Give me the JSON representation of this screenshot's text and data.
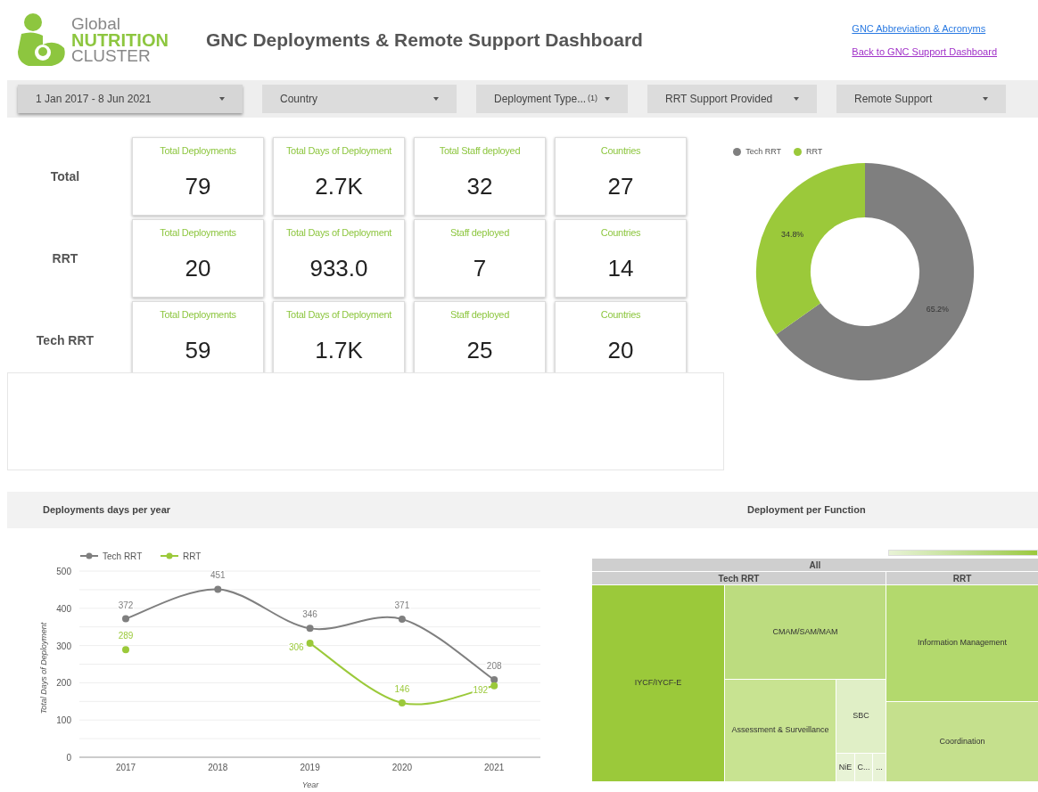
{
  "logo": {
    "line_1": "Global",
    "line_2": "NUTRITION",
    "line_3": "CLUSTER"
  },
  "title": "GNC Deployments & Remote Support Dashboard",
  "links": [
    {
      "label": "GNC Abbreviation & Acronyms",
      "visited": false
    },
    {
      "label": "Back to GNC Support Dashboard",
      "visited": true
    }
  ],
  "filters": [
    {
      "label": "1 Jan 2017 - 8 Jun 2021",
      "kind": "date"
    },
    {
      "label": "Country",
      "kind": "dropdown"
    },
    {
      "label": "Deployment Type...",
      "kind": "dropdown",
      "count": "(1)"
    },
    {
      "label": "RRT Support Provided",
      "kind": "dropdown"
    },
    {
      "label": "Remote Support",
      "kind": "dropdown"
    }
  ],
  "kpi_rows": [
    {
      "label": "Total",
      "cards": [
        {
          "title": "Total Deployments",
          "value": "79"
        },
        {
          "title": "Total Days of Deployment",
          "value": "2.7K"
        },
        {
          "title": "Total Staff deployed",
          "value": "32"
        },
        {
          "title": "Countries",
          "value": "27"
        }
      ]
    },
    {
      "label": "RRT",
      "cards": [
        {
          "title": "Total Deployments",
          "value": "20"
        },
        {
          "title": "Total Days of Deployment",
          "value": "933.0"
        },
        {
          "title": "Staff deployed",
          "value": "7"
        },
        {
          "title": "Countries",
          "value": "14"
        }
      ]
    },
    {
      "label": "Tech RRT",
      "cards": [
        {
          "title": "Total Deployments",
          "value": "59"
        },
        {
          "title": "Total Days of Deployment",
          "value": "1.7K"
        },
        {
          "title": "Staff deployed",
          "value": "25"
        },
        {
          "title": "Countries",
          "value": "20"
        }
      ]
    }
  ],
  "donut": {
    "chart_data": {
      "type": "donut",
      "legend": "top-left",
      "categories": [
        "Tech RRT",
        "RRT"
      ],
      "values": [
        65.2,
        34.8
      ],
      "colors": [
        "#7f7f7f",
        "#9bc93a"
      ],
      "value_labels": [
        "65.2%",
        "34.8%"
      ]
    }
  },
  "sections": [
    {
      "title": "Deployments days per year"
    },
    {
      "title": "Deployment per Function"
    }
  ],
  "line_chart": {
    "chart_data": {
      "type": "line",
      "legend": "top-left",
      "grid": true,
      "xlabel": "Year",
      "ylabel": "Total Days of Deployment",
      "categories": [
        "2017",
        "2018",
        "2019",
        "2020",
        "2021"
      ],
      "ylim": [
        0,
        500
      ],
      "yticks": [
        0,
        100,
        200,
        300,
        400,
        500
      ],
      "data_labels": true,
      "series": [
        {
          "name": "Tech RRT",
          "color": "#7f7f7f",
          "marker": "circle",
          "values": [
            372,
            451,
            346,
            371,
            208
          ]
        },
        {
          "name": "RRT",
          "color": "#9bc93a",
          "marker": "circle",
          "values": [
            289,
            null,
            306,
            146,
            192
          ]
        }
      ]
    }
  },
  "treemap": {
    "header": "All",
    "groups": [
      {
        "label": "Tech RRT",
        "cells": [
          {
            "label": "IYCF/IYCF-E",
            "color": "#9bc93a"
          },
          {
            "label": "CMAM/SAM/MAM",
            "color": "#bcdc7f"
          },
          {
            "label": "Assessment & Surveillance",
            "color": "#c8e391"
          },
          {
            "label": "SBC",
            "color": "#e0efc6"
          },
          {
            "label": "NiE",
            "color": "#e8f3d6"
          },
          {
            "label": "C...",
            "color": "#e8f3d6"
          },
          {
            "label": "...",
            "color": "#e8f3d6"
          }
        ]
      },
      {
        "label": "RRT",
        "cells": [
          {
            "label": "Information Management",
            "color": "#b3d96d"
          },
          {
            "label": "Coordination",
            "color": "#c5e08d"
          }
        ]
      }
    ]
  }
}
